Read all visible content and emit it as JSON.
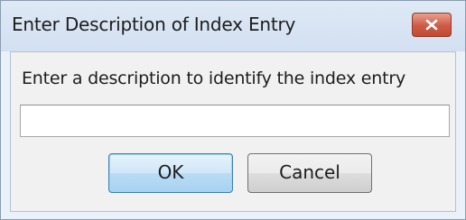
{
  "window": {
    "title": "Enter Description of Index Entry"
  },
  "dialog": {
    "prompt": "Enter a description to identify the index entry",
    "input_value": "",
    "ok_label": "OK",
    "cancel_label": "Cancel"
  },
  "icons": {
    "close": "close-icon"
  },
  "colors": {
    "titlebar": "#d8e4f3",
    "close_button": "#c9513a",
    "ok_button_border": "#3c7fb1",
    "client_background": "#f1f1f1"
  }
}
